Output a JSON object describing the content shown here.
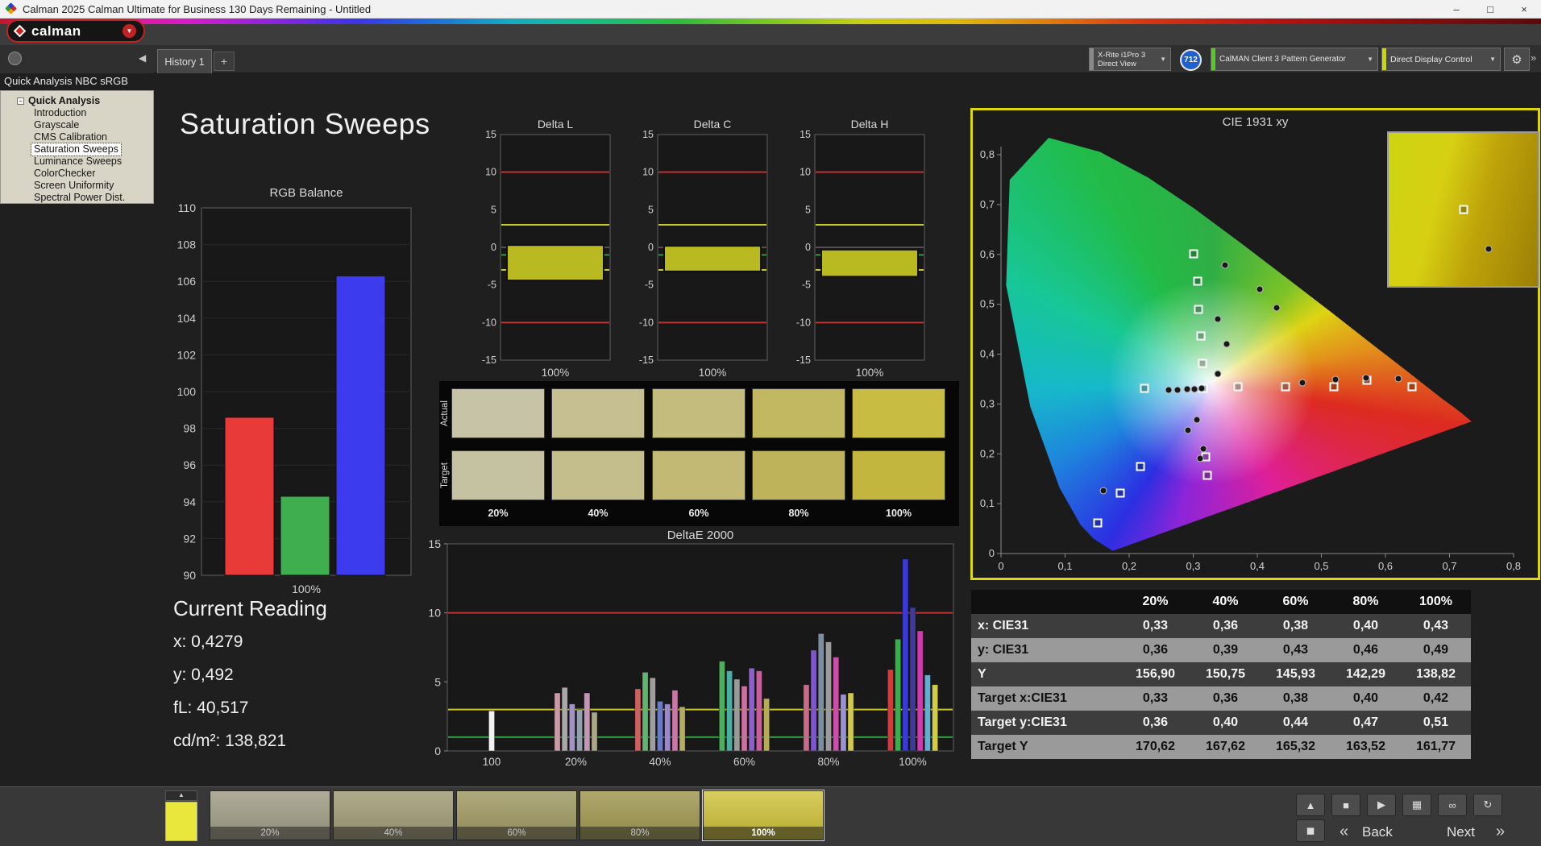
{
  "window": {
    "title": "Calman 2025 Calman Ultimate for Business 130 Days Remaining  - Untitled",
    "controls": {
      "minimize": "–",
      "maximize": "□",
      "close": "×"
    }
  },
  "icons": {
    "caret_down": "▼",
    "caret_up": "▲",
    "collapse_left": "◀",
    "gear": "⚙",
    "overflow": "»",
    "tree_expander": "−",
    "back_chevrons": "«",
    "next_chevrons": "»"
  },
  "toolbar": {
    "brand": "calman",
    "meter": {
      "line1": "X-Rite i1Pro 3",
      "line2": "Direct View"
    },
    "badge": "712",
    "pattern_source": "CalMAN Client 3 Pattern Generator",
    "display_control": "Direct Display Control"
  },
  "tabs": {
    "history": "History 1",
    "add": "+"
  },
  "sidebar": {
    "workflow_title": "Quick Analysis NBC sRGB",
    "root": "Quick Analysis",
    "items": [
      "Introduction",
      "Grayscale",
      "CMS Calibration",
      "Saturation Sweeps",
      "Luminance Sweeps",
      "ColorChecker",
      "Screen Uniformity",
      "Spectral Power Dist."
    ],
    "selected_index": 3
  },
  "page": {
    "title": "Saturation Sweeps"
  },
  "current_reading": {
    "heading": "Current Reading",
    "x": "x: 0,4279",
    "y": "y: 0,492",
    "fl": "fL: 40,517",
    "cdm2": "cd/m²: 138,821"
  },
  "swatch_matrix": {
    "row_labels": [
      "Actual",
      "Target"
    ],
    "col_labels": [
      "20%",
      "40%",
      "60%",
      "80%",
      "100%"
    ],
    "actual_colors": [
      "#c6c3a6",
      "#c6bf92",
      "#c4bc7c",
      "#c2b862",
      "#c9bc42"
    ],
    "target_colors": [
      "#c5c2a2",
      "#c4bd8c",
      "#c2b974",
      "#beb35a",
      "#c3b63e"
    ]
  },
  "results_table": {
    "col_headers": [
      "20%",
      "40%",
      "60%",
      "80%",
      "100%"
    ],
    "rows": [
      {
        "label": "x: CIE31",
        "values": [
          "0,33",
          "0,36",
          "0,38",
          "0,40",
          "0,43"
        ],
        "shade": "dark"
      },
      {
        "label": "y: CIE31",
        "values": [
          "0,36",
          "0,39",
          "0,43",
          "0,46",
          "0,49"
        ],
        "shade": "light"
      },
      {
        "label": "Y",
        "values": [
          "156,90",
          "150,75",
          "145,93",
          "142,29",
          "138,82"
        ],
        "shade": "dark"
      },
      {
        "label": "Target x:CIE31",
        "values": [
          "0,33",
          "0,36",
          "0,38",
          "0,40",
          "0,42"
        ],
        "shade": "light"
      },
      {
        "label": "Target y:CIE31",
        "values": [
          "0,36",
          "0,40",
          "0,44",
          "0,47",
          "0,51"
        ],
        "shade": "dark"
      },
      {
        "label": "Target Y",
        "values": [
          "170,62",
          "167,62",
          "165,32",
          "163,52",
          "161,77"
        ],
        "shade": "light"
      }
    ]
  },
  "bottom_bar": {
    "pattern_color": "#eae73c",
    "popout_glyph": "▲",
    "fullscreen_glyph": "◼",
    "transport": [
      {
        "name": "stop",
        "glyph": "■"
      },
      {
        "name": "play",
        "glyph": "▶"
      },
      {
        "name": "save",
        "glyph": "▦"
      },
      {
        "name": "loop",
        "glyph": "∞"
      },
      {
        "name": "refresh",
        "glyph": "↻"
      }
    ],
    "swatches": [
      {
        "label": "20%",
        "color": "#bab698",
        "selected": false
      },
      {
        "label": "40%",
        "color": "#bbb483",
        "selected": false
      },
      {
        "label": "60%",
        "color": "#bab26c",
        "selected": false
      },
      {
        "label": "80%",
        "color": "#bbb054",
        "selected": false
      },
      {
        "label": "100%",
        "color": "#cdc033",
        "selected": true
      }
    ],
    "back": "Back",
    "next": "Next"
  },
  "chart_data": [
    {
      "id": "rgb_balance",
      "type": "bar",
      "title": "RGB Balance",
      "categories": [
        "Red",
        "Green",
        "Blue"
      ],
      "values": [
        98.6,
        94.3,
        106.3
      ],
      "colors": [
        "#e93a3a",
        "#3fae4e",
        "#3c3cee"
      ],
      "ylim": [
        90,
        110
      ],
      "ytick_step": 2,
      "xlabel": "100%"
    },
    {
      "id": "delta_l",
      "type": "range_bar",
      "title": "Delta L",
      "ylim": [
        -15,
        15
      ],
      "ytick_step": 5,
      "xlabel": "100%",
      "bar": {
        "from": 0.3,
        "to": -4.4,
        "color": "#b9b921"
      },
      "ref_lines": [
        {
          "y": 10,
          "color": "#c23232"
        },
        {
          "y": -10,
          "color": "#c23232"
        },
        {
          "y": 3,
          "color": "#c9c92a"
        },
        {
          "y": -3,
          "color": "#c9c92a"
        },
        {
          "y": -1,
          "color": "#2f9e3f"
        },
        {
          "y": 0,
          "color": "#8a8a8a"
        }
      ]
    },
    {
      "id": "delta_c",
      "type": "range_bar",
      "title": "Delta C",
      "ylim": [
        -15,
        15
      ],
      "ytick_step": 5,
      "xlabel": "100%",
      "bar": {
        "from": 0.2,
        "to": -3.2,
        "color": "#b9b921"
      },
      "ref_lines": [
        {
          "y": 10,
          "color": "#c23232"
        },
        {
          "y": -10,
          "color": "#c23232"
        },
        {
          "y": 3,
          "color": "#c9c92a"
        },
        {
          "y": -3,
          "color": "#c9c92a"
        },
        {
          "y": -1,
          "color": "#2f9e3f"
        },
        {
          "y": 0,
          "color": "#8a8a8a"
        }
      ]
    },
    {
      "id": "delta_h",
      "type": "range_bar",
      "title": "Delta H",
      "ylim": [
        -15,
        15
      ],
      "ytick_step": 5,
      "xlabel": "100%",
      "bar": {
        "from": -0.3,
        "to": -3.9,
        "color": "#b9b921"
      },
      "ref_lines": [
        {
          "y": 10,
          "color": "#c23232"
        },
        {
          "y": -10,
          "color": "#c23232"
        },
        {
          "y": 3,
          "color": "#c9c92a"
        },
        {
          "y": -3,
          "color": "#c9c92a"
        },
        {
          "y": -1,
          "color": "#2f9e3f"
        },
        {
          "y": 0,
          "color": "#8a8a8a"
        }
      ]
    },
    {
      "id": "deltae_2000",
      "type": "grouped_bar",
      "title": "DeltaE 2000",
      "ylim": [
        0,
        15
      ],
      "yticks": [
        0,
        5,
        10,
        15
      ],
      "ref_lines": [
        {
          "y": 10,
          "color": "#c23232"
        },
        {
          "y": 3,
          "color": "#c9c92a"
        },
        {
          "y": 1,
          "color": "#2f9e3f"
        }
      ],
      "groups": [
        {
          "label": "100",
          "bars": [
            {
              "color": "#f2f2f2",
              "value": 2.9
            }
          ]
        },
        {
          "label": "20%",
          "bars": [
            {
              "color": "#c99ba6",
              "value": 4.2
            },
            {
              "color": "#a8a8a8",
              "value": 4.6
            },
            {
              "color": "#a393c4",
              "value": 3.4
            },
            {
              "color": "#93a0ad",
              "value": 3.0
            },
            {
              "color": "#c397b4",
              "value": 4.2
            },
            {
              "color": "#aaa78b",
              "value": 2.8
            }
          ]
        },
        {
          "label": "40%",
          "bars": [
            {
              "color": "#cd6060",
              "value": 4.5
            },
            {
              "color": "#62b470",
              "value": 5.7
            },
            {
              "color": "#9e9e9e",
              "value": 5.3
            },
            {
              "color": "#6a79c9",
              "value": 3.6
            },
            {
              "color": "#9c86cc",
              "value": 3.4
            },
            {
              "color": "#c878a4",
              "value": 4.4
            },
            {
              "color": "#b3ab61",
              "value": 3.2
            }
          ]
        },
        {
          "label": "60%",
          "bars": [
            {
              "color": "#4fae5c",
              "value": 6.5
            },
            {
              "color": "#4caea2",
              "value": 5.8
            },
            {
              "color": "#9a9a9a",
              "value": 5.2
            },
            {
              "color": "#c9729f",
              "value": 4.7
            },
            {
              "color": "#8a62c9",
              "value": 6.0
            },
            {
              "color": "#c75f9b",
              "value": 5.8
            },
            {
              "color": "#b5ac55",
              "value": 3.8
            }
          ]
        },
        {
          "label": "80%",
          "bars": [
            {
              "color": "#c96a86",
              "value": 4.8
            },
            {
              "color": "#7e58c9",
              "value": 7.3
            },
            {
              "color": "#7d8ea0",
              "value": 8.5
            },
            {
              "color": "#9b9b9b",
              "value": 7.9
            },
            {
              "color": "#c94fa8",
              "value": 6.8
            },
            {
              "color": "#9a93cf",
              "value": 4.1
            },
            {
              "color": "#cfc94f",
              "value": 4.2
            }
          ]
        },
        {
          "label": "100%",
          "bars": [
            {
              "color": "#d23b3b",
              "value": 5.9
            },
            {
              "color": "#3bae4c",
              "value": 8.1
            },
            {
              "color": "#3a3ad6",
              "value": 13.9
            },
            {
              "color": "#3c3c96",
              "value": 10.4
            },
            {
              "color": "#cd3bad",
              "value": 8.7
            },
            {
              "color": "#62aed2",
              "value": 5.5
            },
            {
              "color": "#d2cc4a",
              "value": 4.8
            }
          ]
        }
      ]
    },
    {
      "id": "cie_1931",
      "type": "scatter",
      "title": "CIE 1931 xy",
      "xlim": [
        0,
        0.8
      ],
      "ylim": [
        0,
        0.8
      ],
      "tick_step": 0.1,
      "tick_labels": [
        "0",
        "0,1",
        "0,2",
        "0,3",
        "0,4",
        "0,5",
        "0,6",
        "0,7",
        "0,8"
      ],
      "targets": [
        [
          0.3,
          0.601
        ],
        [
          0.307,
          0.547
        ],
        [
          0.308,
          0.49
        ],
        [
          0.312,
          0.436
        ],
        [
          0.315,
          0.382
        ],
        [
          0.37,
          0.334
        ],
        [
          0.444,
          0.334
        ],
        [
          0.52,
          0.334
        ],
        [
          0.571,
          0.347
        ],
        [
          0.642,
          0.334
        ],
        [
          0.224,
          0.332
        ],
        [
          0.316,
          0.332
        ],
        [
          0.32,
          0.194
        ],
        [
          0.322,
          0.157
        ],
        [
          0.218,
          0.175
        ],
        [
          0.186,
          0.121
        ],
        [
          0.151,
          0.062
        ]
      ],
      "measurements": [
        [
          0.35,
          0.578
        ],
        [
          0.338,
          0.471
        ],
        [
          0.43,
          0.493
        ],
        [
          0.404,
          0.53
        ],
        [
          0.47,
          0.343
        ],
        [
          0.522,
          0.349
        ],
        [
          0.57,
          0.353
        ],
        [
          0.62,
          0.351
        ],
        [
          0.262,
          0.328
        ],
        [
          0.276,
          0.328
        ],
        [
          0.29,
          0.33
        ],
        [
          0.302,
          0.33
        ],
        [
          0.313,
          0.331
        ],
        [
          0.306,
          0.268
        ],
        [
          0.292,
          0.247
        ],
        [
          0.316,
          0.21
        ],
        [
          0.311,
          0.19
        ],
        [
          0.16,
          0.126
        ],
        [
          0.352,
          0.42
        ],
        [
          0.338,
          0.36
        ]
      ],
      "inset": {
        "square": [
          0.5,
          0.5
        ],
        "circle": [
          0.67,
          0.76
        ]
      }
    }
  ]
}
